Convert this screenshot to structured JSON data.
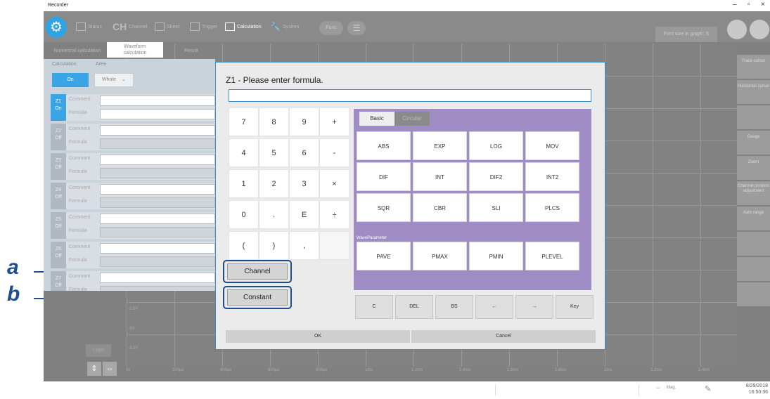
{
  "window": {
    "title": "Recorder",
    "controls": [
      "–",
      "▫",
      "×"
    ]
  },
  "toolbar": {
    "tabs": [
      {
        "label": "Status",
        "icon": "status-icon"
      },
      {
        "label": "Channel",
        "icon": "channel-icon",
        "prefix": "CH"
      },
      {
        "label": "Sheet",
        "icon": "sheet-icon"
      },
      {
        "label": "Trigger",
        "icon": "trigger-icon"
      },
      {
        "label": "Calculation",
        "icon": "calculation-icon"
      },
      {
        "label": "System",
        "icon": "wrench-icon"
      }
    ],
    "func_label": "Func",
    "font_size_label": "Font size in graph: S"
  },
  "subtabs": [
    "Numerical calculation",
    "Waveform\ncalculation",
    "Result"
  ],
  "left_panel": {
    "calculation_label": "Calculation",
    "area_label": "Area",
    "calculation_value": "On",
    "area_value": "Whole",
    "comment_label": "Comment",
    "formula_label": "Formula",
    "rows": [
      {
        "id": "Z1",
        "state": "On"
      },
      {
        "id": "Z2",
        "state": "Off"
      },
      {
        "id": "Z3",
        "state": "Off"
      },
      {
        "id": "Z4",
        "state": "Off"
      },
      {
        "id": "Z5",
        "state": "Off"
      },
      {
        "id": "Z6",
        "state": "Off"
      },
      {
        "id": "Z7",
        "state": "Off"
      }
    ],
    "logic_label": "Logic"
  },
  "right_panel": {
    "buttons": [
      "Trace cursor",
      "Horizontal cursor",
      "",
      "Gauge",
      "Zoom",
      "Channel position adjustment",
      "Auto range",
      "",
      "",
      ""
    ]
  },
  "graph": {
    "x_ticks": [
      "0s",
      "200µs",
      "400µs",
      "600µs",
      "800µs",
      "1ms",
      "1.2ms",
      "1.4ms",
      "1.6ms",
      "1.8ms",
      "2ms",
      "2.2ms",
      "2.4ms"
    ],
    "y_ticks": [
      "-2.5V",
      "-3V",
      "-3.5V"
    ]
  },
  "dialog": {
    "title": "Z1 - Please enter formula.",
    "formula_value": "",
    "keypad": [
      "7",
      "8",
      "9",
      "+",
      "4",
      "5",
      "6",
      "-",
      "1",
      "2",
      "3",
      "×",
      "0",
      ".",
      "E",
      "÷",
      "(",
      ")",
      ",",
      ""
    ],
    "channel_label": "Channel",
    "constant_label": "Constant",
    "function_tabs": [
      "Basic",
      "Circular"
    ],
    "functions": [
      "ABS",
      "EXP",
      "LOG",
      "MOV",
      "DIF",
      "INT",
      "DIF2",
      "INT2",
      "SQR",
      "CBR",
      "SLI",
      "PLCS"
    ],
    "wave_parameter_label": "WaveParameter",
    "wave_functions": [
      "PAVE",
      "PMAX",
      "PMIN",
      "PLEVEL"
    ],
    "edit_keys": [
      "C",
      "DEL",
      "BS",
      "←",
      "→",
      "Key"
    ],
    "ok_label": "OK",
    "cancel_label": "Cancel"
  },
  "callouts": [
    "a",
    "b"
  ],
  "status_bar": {
    "mag_label": "Mag.",
    "date": "8/29/2018",
    "time": "16:50:36"
  },
  "colors": {
    "accent": "#2ea3e6",
    "callout": "#1f4e8c",
    "function_panel": "#a08cc4",
    "dialog_border": "#3a8fd0"
  }
}
